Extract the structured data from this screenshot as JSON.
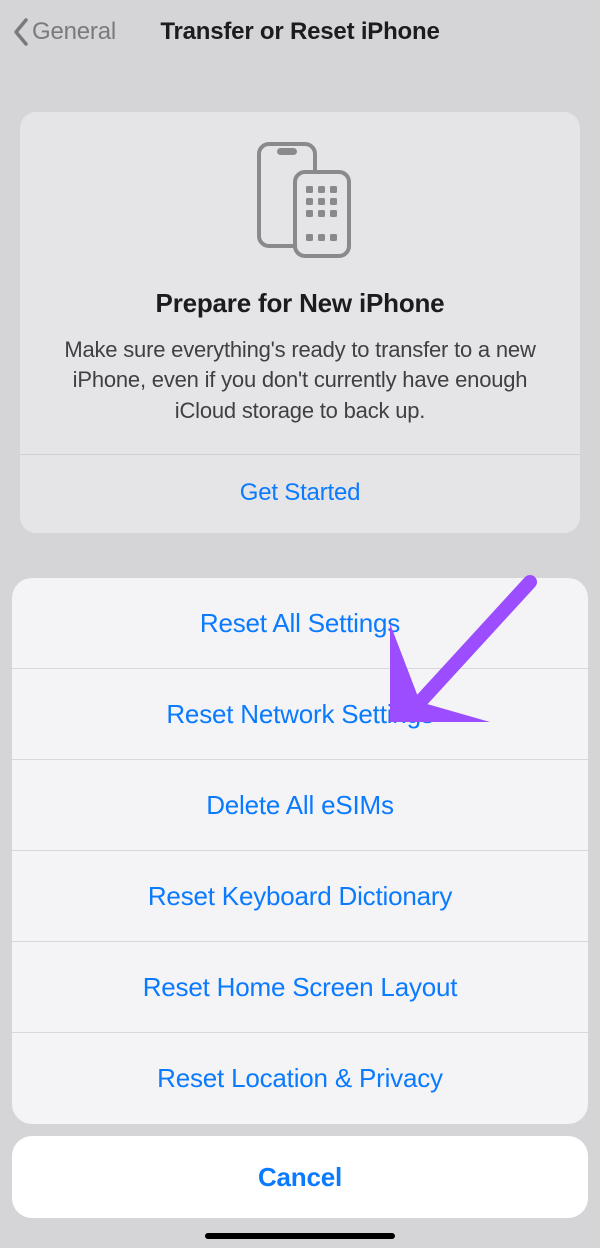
{
  "nav": {
    "back_label": "General",
    "title": "Transfer or Reset iPhone"
  },
  "prepare_card": {
    "title": "Prepare for New iPhone",
    "description": "Make sure everything's ready to transfer to a new iPhone, even if you don't currently have enough iCloud storage to back up.",
    "cta": "Get Started"
  },
  "action_sheet": {
    "items": [
      "Reset All Settings",
      "Reset Network Settings",
      "Delete All eSIMs",
      "Reset Keyboard Dictionary",
      "Reset Home Screen Layout",
      "Reset Location & Privacy"
    ],
    "cancel": "Cancel"
  },
  "colors": {
    "link": "#0a7aff",
    "annotation_arrow": "#9b4dff"
  }
}
